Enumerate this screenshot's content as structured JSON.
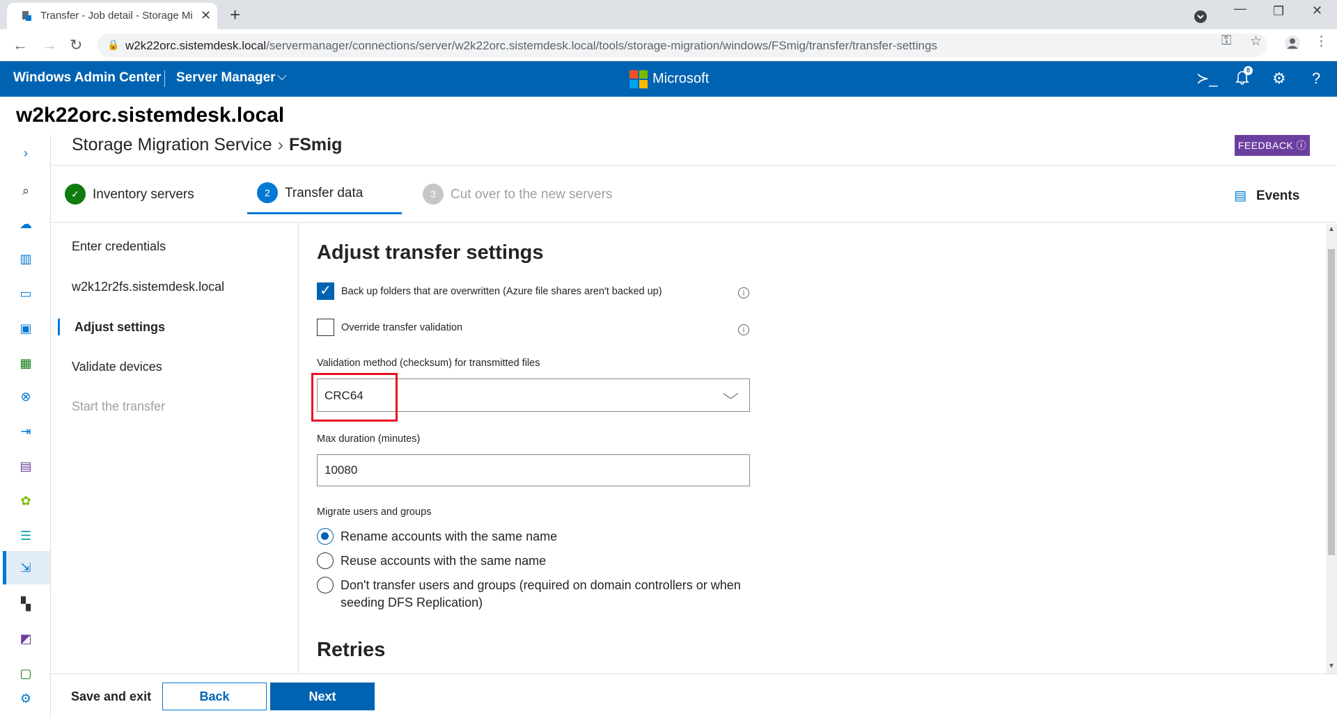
{
  "browser": {
    "tab_title": "Transfer - Job detail - Storage Mi",
    "url_host": "w2k22orc.sistemdesk.local",
    "url_path": "/servermanager/connections/server/w2k22orc.sistemdesk.local/tools/storage-migration/windows/FSmig/transfer/transfer-settings"
  },
  "header": {
    "brand": "Windows Admin Center",
    "manager": "Server Manager",
    "ms": "Microsoft",
    "notif_count": "8"
  },
  "server_name": "w2k22orc.sistemdesk.local",
  "breadcrumb": {
    "parent": "Storage Migration Service",
    "current": "FSmig"
  },
  "feedback": "FEEDBACK",
  "steps": [
    {
      "num": "",
      "label": "Inventory servers",
      "state": "done"
    },
    {
      "num": "2",
      "label": "Transfer data",
      "state": "active"
    },
    {
      "num": "3",
      "label": "Cut over to the new servers",
      "state": "disabled"
    }
  ],
  "events": "Events",
  "subnav": [
    {
      "label": "Enter credentials"
    },
    {
      "label": "w2k12r2fs.sistemdesk.local"
    },
    {
      "label": "Adjust settings"
    },
    {
      "label": "Validate devices"
    },
    {
      "label": "Start the transfer"
    }
  ],
  "settings": {
    "title": "Adjust transfer settings",
    "backup_label": "Back up folders that are overwritten (Azure file shares aren't backed up)",
    "backup_checked": true,
    "override_label": "Override transfer validation",
    "override_checked": false,
    "validation_label": "Validation method (checksum) for transmitted files",
    "validation_value": "CRC64",
    "duration_label": "Max duration (minutes)",
    "duration_value": "10080",
    "migrate_label": "Migrate users and groups",
    "radios": [
      {
        "label": "Rename accounts with the same name",
        "selected": true
      },
      {
        "label": "Reuse accounts with the same name",
        "selected": false
      },
      {
        "label": "Don't transfer users and groups (required on domain controllers or when seeding DFS Replication)",
        "selected": false
      }
    ],
    "retries_title": "Retries"
  },
  "footer": {
    "save_exit": "Save and exit",
    "back": "Back",
    "next": "Next"
  },
  "colors": {
    "accent": "#0063b1",
    "feedback": "#6b3fa0",
    "highlight": "#e81123",
    "success": "#107c10"
  },
  "icons": {
    "rail": [
      "expand-icon",
      "search-icon",
      "azure-icon",
      "chart-icon",
      "console-icon",
      "dashboard-icon",
      "apps-icon",
      "network-icon",
      "import-icon",
      "calendar-icon",
      "gear-sync-icon",
      "storage-icon",
      "migration-icon",
      "replica-icon",
      "analytics-icon",
      "monitor-icon",
      "settings-icon"
    ]
  }
}
